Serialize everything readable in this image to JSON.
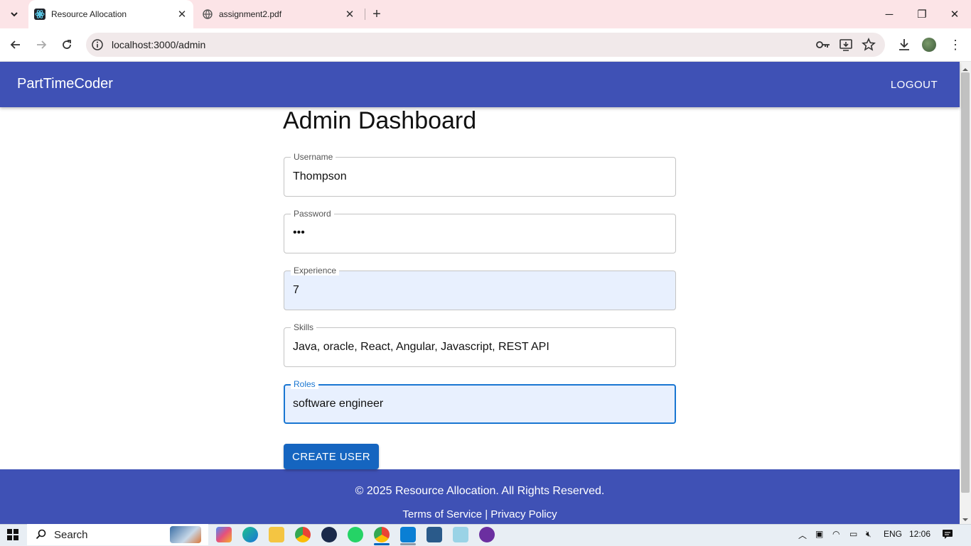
{
  "browser": {
    "tabs": [
      {
        "title": "Resource Allocation",
        "active": true,
        "icon": "react-icon"
      },
      {
        "title": "assignment2.pdf",
        "active": false,
        "icon": "globe-icon"
      }
    ],
    "url": "localhost:3000/admin"
  },
  "app": {
    "brand": "PartTimeCoder",
    "logout_label": "LOGOUT",
    "page_title": "Admin Dashboard",
    "form": {
      "username": {
        "label": "Username",
        "value": "Thompson"
      },
      "password": {
        "label": "Password",
        "value": "•••"
      },
      "experience": {
        "label": "Experience",
        "value": "7"
      },
      "skills": {
        "label": "Skills",
        "value": "Java, oracle, React, Angular, Javascript, REST API"
      },
      "roles": {
        "label": "Roles",
        "value": "software engineer"
      }
    },
    "create_button": "CREATE USER",
    "footer": {
      "copyright": "© 2025 Resource Allocation. All Rights Reserved.",
      "links": "Terms of Service | Privacy Policy"
    },
    "colors": {
      "primary": "#3f51b5",
      "button": "#1565c0",
      "focus": "#1976d2"
    }
  },
  "taskbar": {
    "search_placeholder": "Search",
    "language": "ENG",
    "time": "12:06"
  }
}
